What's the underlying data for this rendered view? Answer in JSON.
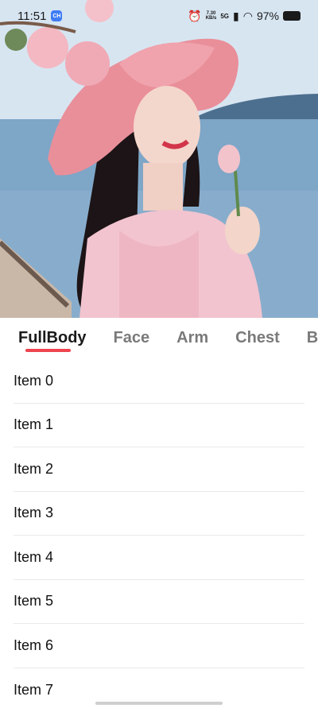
{
  "status_bar": {
    "time": "11:51",
    "app_badge": "CH",
    "net_speed_value": "7.30",
    "net_speed_unit": "KB/s",
    "network_type": "5G",
    "battery_percent": "97%"
  },
  "hero": {
    "image_icon": "photo-of-woman-in-pink-hat"
  },
  "tabs": [
    {
      "label": "FullBody",
      "selected": true
    },
    {
      "label": "Face",
      "selected": false
    },
    {
      "label": "Arm",
      "selected": false
    },
    {
      "label": "Chest",
      "selected": false
    },
    {
      "label": "B",
      "selected": false
    }
  ],
  "list": {
    "items": [
      "Item 0",
      "Item 1",
      "Item 2",
      "Item 3",
      "Item 4",
      "Item 5",
      "Item 6",
      "Item 7"
    ]
  },
  "colors": {
    "accent": "#ee4450",
    "tab_selected": "#1a1a1a",
    "tab_unselected": "#7a7a7a"
  }
}
